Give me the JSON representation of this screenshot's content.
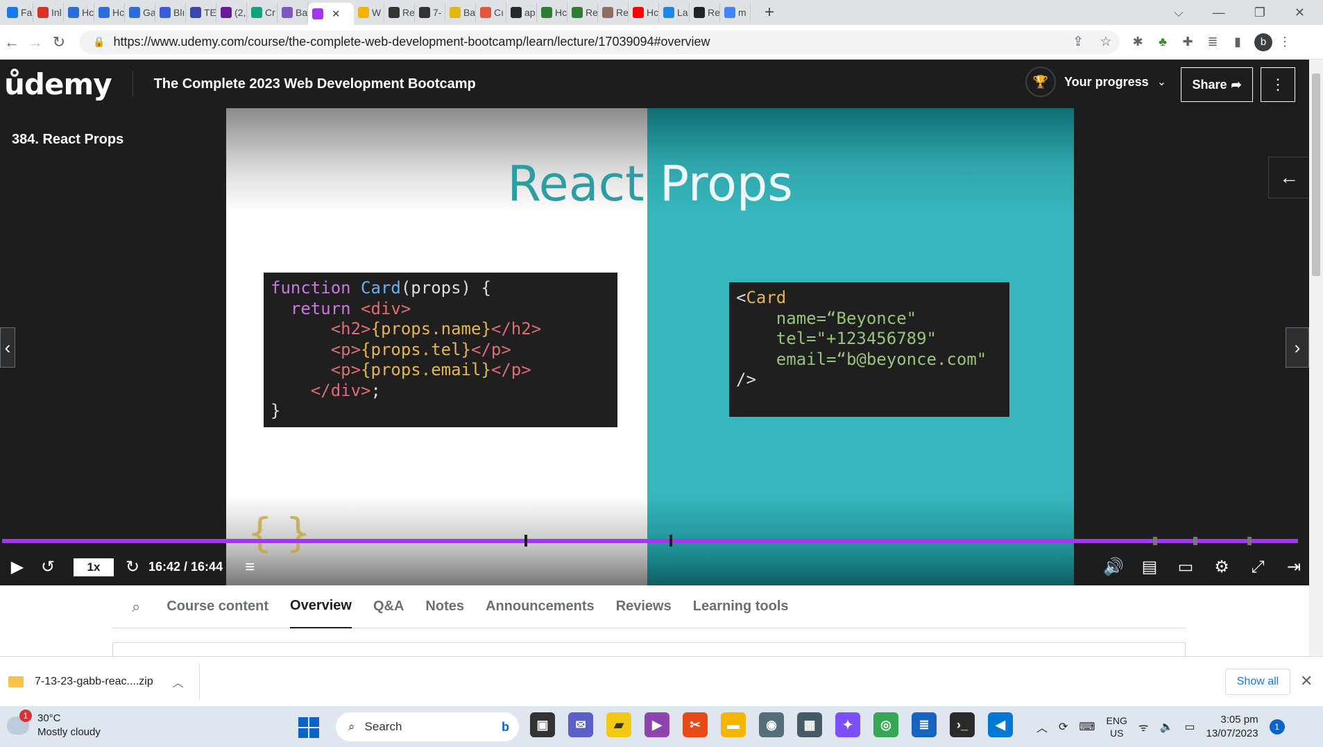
{
  "browser": {
    "tabs": [
      {
        "label": "Fa",
        "icon": "facebook-icon",
        "color": "#1877f2"
      },
      {
        "label": "Inl",
        "icon": "gmail-icon",
        "color": "#d93025"
      },
      {
        "label": "Hc",
        "icon": "c-circle-icon",
        "color": "#2d6cdf"
      },
      {
        "label": "Hc",
        "icon": "c-circle-icon",
        "color": "#2d6cdf"
      },
      {
        "label": "Ga",
        "icon": "c-circle-icon",
        "color": "#2d6cdf"
      },
      {
        "label": "Blı",
        "icon": "shield-icon",
        "color": "#3b5bdb"
      },
      {
        "label": "TE",
        "icon": "gear-icon",
        "color": "#3949ab"
      },
      {
        "label": "(2,",
        "icon": "mail-icon",
        "color": "#6a1b9a"
      },
      {
        "label": "Cr",
        "icon": "openai-icon",
        "color": "#10a37f"
      },
      {
        "label": "Ba",
        "icon": "sparkle-icon",
        "color": "#7e57c2"
      },
      {
        "label": "",
        "icon": "udemy-icon",
        "color": "#a435f0"
      },
      {
        "label": "W",
        "icon": "w-icon",
        "color": "#f0b400"
      },
      {
        "label": "Re",
        "icon": "square-icon",
        "color": "#333333"
      },
      {
        "label": "7-",
        "icon": "square-icon",
        "color": "#333333"
      },
      {
        "label": "Ba",
        "icon": "pen-icon",
        "color": "#e2b714"
      },
      {
        "label": "Cı",
        "icon": "cloud-icon",
        "color": "#e2583e"
      },
      {
        "label": "ap",
        "icon": "github-icon",
        "color": "#24292f"
      },
      {
        "label": "Hc",
        "icon": "w-icon",
        "color": "#2e7d32"
      },
      {
        "label": "Re",
        "icon": "w-icon",
        "color": "#2e7d32"
      },
      {
        "label": "Re",
        "icon": "image-icon",
        "color": "#8d6e63"
      },
      {
        "label": "Hc",
        "icon": "youtube-icon",
        "color": "#ff0000"
      },
      {
        "label": "La",
        "icon": "z-icon",
        "color": "#1e88e5"
      },
      {
        "label": "Re",
        "icon": "react-icon",
        "color": "#20232a"
      },
      {
        "label": "m",
        "icon": "google-icon",
        "color": "#4285f4"
      }
    ],
    "active_tab_index": 10,
    "url": "https://www.udemy.com/course/the-complete-web-development-bootcamp/learn/lecture/17039094#overview",
    "profile_initial": "b"
  },
  "udemy": {
    "logo": "ůdemy",
    "course_title": "The Complete 2023 Web Development Bootcamp",
    "progress_label": "Your progress",
    "share_label": "Share",
    "lecture_title": "384. React Props",
    "slide_title_1": "React",
    "slide_title_2": "Props",
    "player": {
      "speed": "1x",
      "time": "16:42 / 16:44",
      "progress_fraction": 0.9988,
      "chapter_marks": [
        0.403,
        0.515,
        0.888,
        0.919,
        0.961
      ]
    },
    "course_tabs": [
      "Course content",
      "Overview",
      "Q&A",
      "Notes",
      "Announcements",
      "Reviews",
      "Learning tools"
    ],
    "active_course_tab": "Overview"
  },
  "code_left": [
    [
      [
        "kw",
        "function "
      ],
      [
        "fn",
        "Card"
      ],
      [
        "pu",
        "(props) {"
      ]
    ],
    [
      [
        "kw",
        "  return "
      ],
      [
        "tg",
        "<div>"
      ]
    ],
    [
      [
        "tg",
        "      <h2>"
      ],
      [
        "at",
        "{props.name}"
      ],
      [
        "tg",
        "</h2>"
      ]
    ],
    [
      [
        "tg",
        "      <p>"
      ],
      [
        "at",
        "{props.tel}"
      ],
      [
        "tg",
        "</p>"
      ]
    ],
    [
      [
        "tg",
        "      <p>"
      ],
      [
        "at",
        "{props.email}"
      ],
      [
        "tg",
        "</p>"
      ]
    ],
    [
      [
        "tg",
        "    </div>"
      ],
      [
        "pu",
        ";"
      ]
    ],
    [
      [
        "pu",
        "}"
      ]
    ]
  ],
  "code_right": [
    [
      [
        "pu",
        "<"
      ],
      [
        "at",
        "Card"
      ]
    ],
    [
      [
        "pu",
        "    "
      ],
      [
        "st",
        "name=“Beyonce\""
      ]
    ],
    [
      [
        "pu",
        "    "
      ],
      [
        "st",
        "tel=\"+123456789\""
      ]
    ],
    [
      [
        "pu",
        "    "
      ],
      [
        "st",
        "email=“b@beyonce.com\""
      ]
    ],
    [
      [
        "pu",
        "/>"
      ]
    ]
  ],
  "downloads": {
    "file": "7-13-23-gabb-reac....zip",
    "show_all": "Show all"
  },
  "taskbar": {
    "temperature": "30°C",
    "weather": "Mostly cloudy",
    "weather_badge": "1",
    "search_placeholder": "Search",
    "lang": "ENG",
    "region": "US",
    "time": "3:05 pm",
    "date": "13/07/2023",
    "notification_count": "1"
  }
}
